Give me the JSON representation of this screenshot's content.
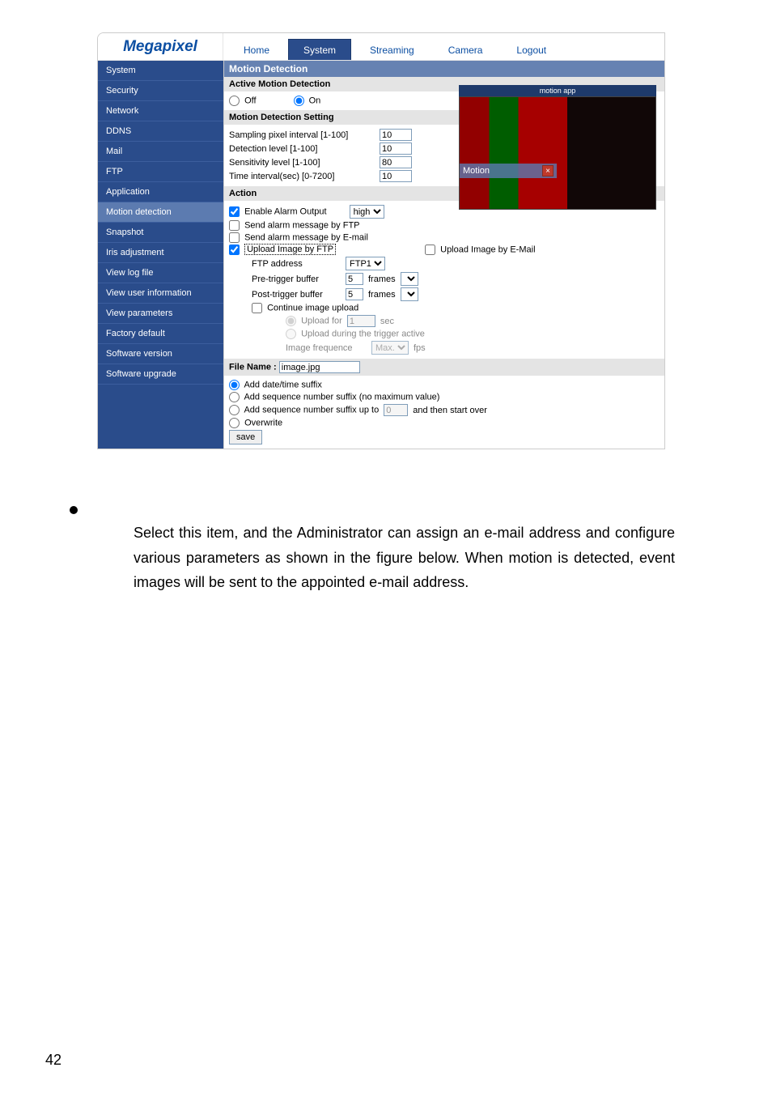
{
  "logo": "Megapixel",
  "tabs": [
    {
      "label": "Home",
      "active": false
    },
    {
      "label": "System",
      "active": true
    },
    {
      "label": "Streaming",
      "active": false
    },
    {
      "label": "Camera",
      "active": false
    },
    {
      "label": "Logout",
      "active": false
    }
  ],
  "sidebar": {
    "items": [
      "System",
      "Security",
      "Network",
      "DDNS",
      "Mail",
      "FTP",
      "Application",
      "Motion detection",
      "Snapshot",
      "Iris adjustment",
      "View log file",
      "View user information",
      "View parameters",
      "Factory default",
      "Software version",
      "Software upgrade"
    ],
    "selected": "Motion detection"
  },
  "panel": {
    "title": "Motion Detection",
    "active_heading": "Active Motion Detection",
    "off": "Off",
    "on": "On",
    "on_selected": true,
    "setting_heading": "Motion Detection Setting",
    "sampling_label": "Sampling pixel interval [1-100]",
    "sampling_value": "10",
    "detection_label": "Detection level [1-100]",
    "detection_value": "10",
    "sensitivity_label": "Sensitivity level [1-100]",
    "sensitivity_value": "80",
    "timeint_label": "Time interval(sec) [0-7200]",
    "timeint_value": "10",
    "action_heading": "Action",
    "enable_alarm": "Enable Alarm Output",
    "enable_alarm_checked": true,
    "alarm_select": "high",
    "send_ftp": "Send alarm message by FTP",
    "send_email": "Send alarm message by E-mail",
    "upload_ftp": "Upload Image by FTP",
    "upload_ftp_checked": true,
    "upload_email": "Upload Image by E-Mail",
    "ftp_address_label": "FTP address",
    "ftp_address_value": "FTP1",
    "pretrig_label": "Pre-trigger buffer",
    "pretrig_val": "5",
    "posttrig_label": "Post-trigger buffer",
    "posttrig_val": "5",
    "frames": "frames",
    "continue_upload": "Continue image upload",
    "upload_for": "Upload for",
    "upload_for_val": "1",
    "sec": "sec",
    "upload_during": "Upload during the trigger active",
    "image_freq": "Image frequence",
    "image_freq_val": "Max.",
    "fps": "fps",
    "file_name_label": "File Name :",
    "file_name_value": "image.jpg",
    "add_datetime": "Add date/time suffix",
    "add_seq_nomax": "Add sequence number suffix (no maximum value)",
    "add_seq_upto": "Add sequence number suffix up to",
    "add_seq_val": "0",
    "and_then": "and then start over",
    "overwrite": "Overwrite",
    "save": "save",
    "preview_caption_app": "motion app",
    "motion_box": "Motion"
  },
  "paragraph": {
    "text": "Select this item, and the Administrator can assign an e-mail address and configure various parameters as shown in the figure below. When motion is detected, event images will be sent to the appointed e-mail address."
  },
  "page_number": "42"
}
